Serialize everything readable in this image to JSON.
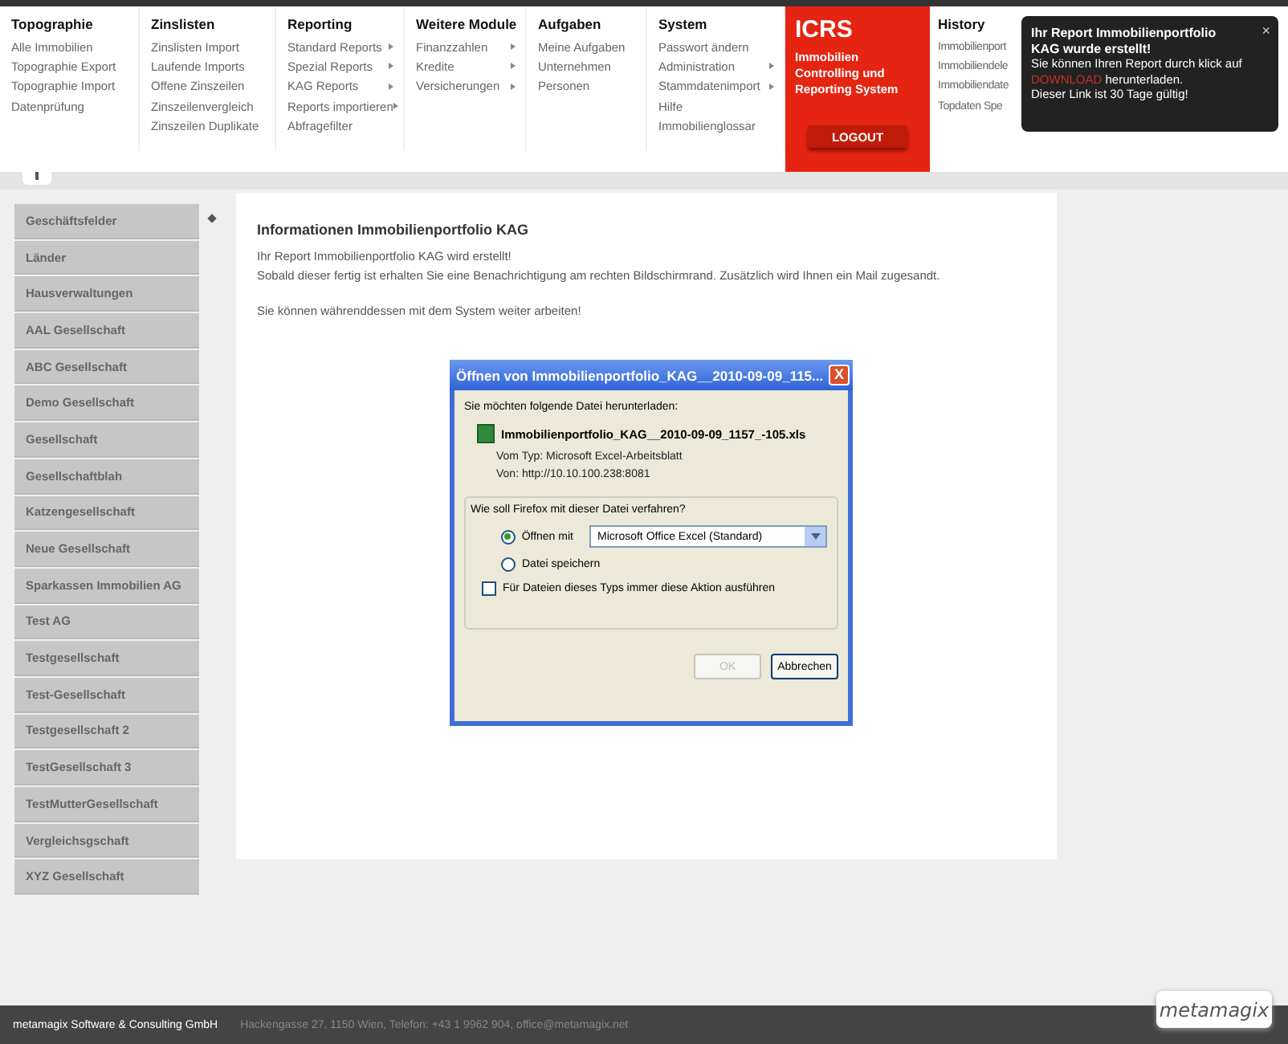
{
  "menu": [
    {
      "title": "Topographie",
      "items": [
        {
          "label": "Alle Immobilien",
          "submenu": false
        },
        {
          "label": "Topographie Export",
          "submenu": false
        },
        {
          "label": "Topographie Import",
          "submenu": false
        },
        {
          "label": "Datenprüfung",
          "submenu": false
        }
      ]
    },
    {
      "title": "Zinslisten",
      "items": [
        {
          "label": "Zinslisten Import",
          "submenu": false
        },
        {
          "label": "Laufende Imports",
          "submenu": false
        },
        {
          "label": "Offene Zinszeilen",
          "submenu": false
        },
        {
          "label": "Zinszeilenvergleich",
          "submenu": false
        },
        {
          "label": "Zinszeilen Duplikate",
          "submenu": false
        }
      ]
    },
    {
      "title": "Reporting",
      "items": [
        {
          "label": "Standard Reports",
          "submenu": true
        },
        {
          "label": "Spezial Reports",
          "submenu": true
        },
        {
          "label": "KAG Reports",
          "submenu": true
        },
        {
          "label": "Reports importieren",
          "submenu": true
        },
        {
          "label": "Abfragefilter",
          "submenu": false
        }
      ]
    },
    {
      "title": "Weitere Module",
      "items": [
        {
          "label": "Finanzzahlen",
          "submenu": true
        },
        {
          "label": "Kredite",
          "submenu": true
        },
        {
          "label": "Versicherungen",
          "submenu": true
        }
      ]
    },
    {
      "title": "Aufgaben",
      "items": [
        {
          "label": "Meine Aufgaben",
          "submenu": false
        },
        {
          "label": "Unternehmen",
          "submenu": false
        },
        {
          "label": "Personen",
          "submenu": false
        }
      ]
    },
    {
      "title": "System",
      "items": [
        {
          "label": "Passwort ändern",
          "submenu": false
        },
        {
          "label": "Administration",
          "submenu": true
        },
        {
          "label": "Stammdatenimport",
          "submenu": true
        },
        {
          "label": "Hilfe",
          "submenu": false
        },
        {
          "label": "Immobilienglossar",
          "submenu": false
        }
      ]
    }
  ],
  "brand": {
    "title": "ICRS",
    "subtitle": "Immobilien Controlling und Reporting System",
    "logout": "LOGOUT"
  },
  "history": {
    "title": "History",
    "items": [
      "Immobilienport",
      "Immobiliendele",
      "Immobiliendate",
      "Topdaten Spe"
    ]
  },
  "notification": {
    "title": "Ihr Report Immobilienportfolio KAG wurde erstellt!",
    "close": "×",
    "text_before": "Sie können Ihren Report durch klick auf",
    "link": "DOWNLOAD",
    "text_after": "herunterladen.",
    "note": "Dieser Link ist 30 Tage gültig!"
  },
  "sidebar": {
    "items": [
      "Geschäftsfelder",
      "Länder",
      "Hausverwaltungen",
      "AAL Gesellschaft",
      "ABC Gesellschaft",
      "Demo Gesellschaft",
      "Gesellschaft",
      "Gesellschaftblah",
      "Katzengesellschaft",
      "Neue Gesellschaft",
      "Sparkassen Immobilien AG",
      "Test AG",
      "Testgesellschaft",
      "Test-Gesellschaft",
      "Testgesellschaft 2",
      "TestGesellschaft 3",
      "TestMutterGesellschaft",
      "Vergleichsgschaft",
      "XYZ Gesellschaft"
    ]
  },
  "panel": {
    "title": "Informationen Immobilienportfolio KAG",
    "paragraphs": [
      [
        "Ihr Report Immobilienportfolio KAG wird erstellt!",
        "Sobald dieser fertig ist erhalten Sie eine Benachrichtigung am rechten Bildschirmrand. Zusätzlich wird Ihnen ein Mail zugesandt."
      ],
      [
        "Sie können währenddessen mit dem System weiter arbeiten!"
      ]
    ]
  },
  "dialog": {
    "title": "Öffnen von Immobilienportfolio_KAG__2010-09-09_115...",
    "close": "X",
    "prompt": "Sie möchten folgende Datei herunterladen:",
    "file": "Immobilienportfolio_KAG__2010-09-09_1157_-105.xls",
    "details": [
      "Vom Typ:  Microsoft Excel-Arbeitsblatt",
      "Von:  http://10.10.100.238:8081"
    ],
    "question": "Wie soll Firefox mit dieser Datei verfahren?",
    "options": [
      {
        "kind": "open",
        "label": "Öffnen mit",
        "selected": true,
        "app": "Microsoft Office Excel (Standard)"
      },
      {
        "kind": "save",
        "label": "Datei speichern",
        "selected": false
      }
    ],
    "remember": {
      "label": "Für Dateien dieses Typs immer diese Aktion ausführen",
      "checked": false
    },
    "buttons": [
      {
        "label": "OK",
        "disabled": true
      },
      {
        "label": "Abbrechen",
        "disabled": false
      }
    ]
  },
  "footer": {
    "company": "metamagix Software & Consulting GmbH",
    "contact": "Hackengasse 27, 1150 Wien, Telefon: +43 1 9962 904, office@metamagix.net",
    "logo": "metamagix"
  }
}
